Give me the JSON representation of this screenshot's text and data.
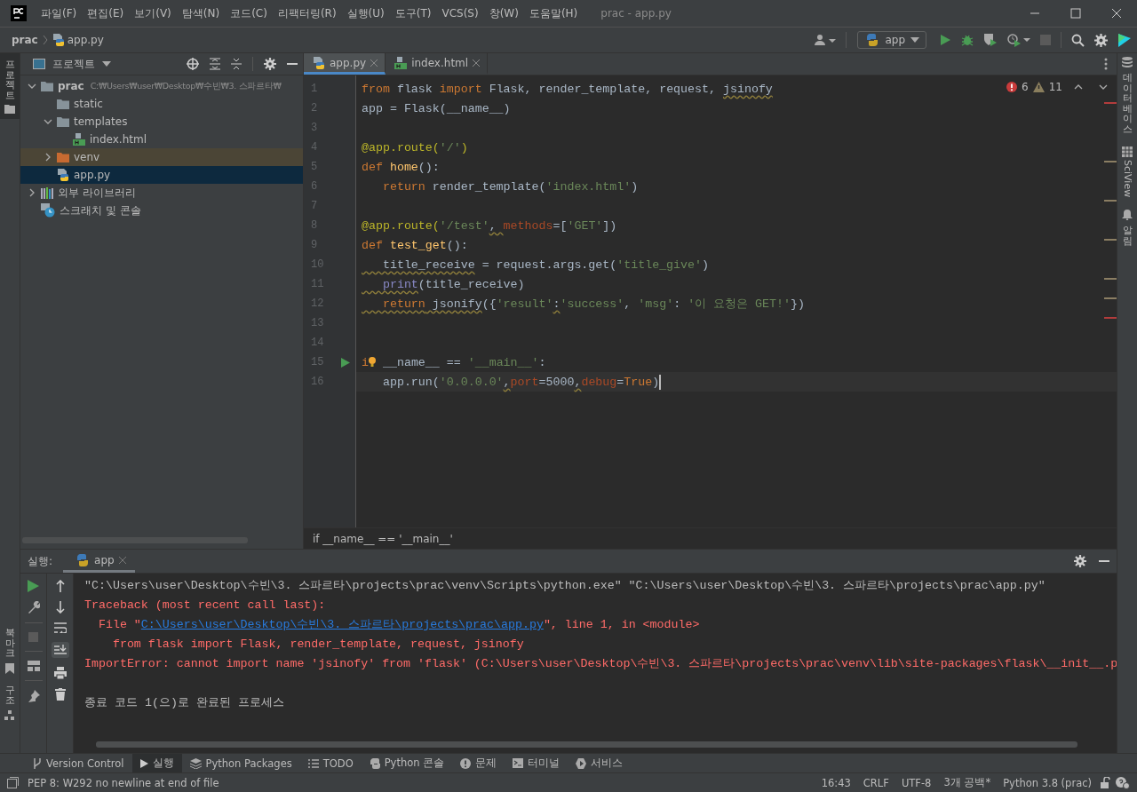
{
  "window": {
    "title": "prac - app.py",
    "menu": [
      "파일(F)",
      "편집(E)",
      "보기(V)",
      "탐색(N)",
      "코드(C)",
      "리팩터링(R)",
      "실행(U)",
      "도구(T)",
      "VCS(S)",
      "창(W)",
      "도움말(H)"
    ]
  },
  "navbar": {
    "breadcrumb": [
      "prac",
      "app.py"
    ],
    "run_config": "app"
  },
  "left_strip": [
    {
      "label": "프로젝트",
      "kind": "project",
      "selected": true
    },
    {
      "label": "북마크",
      "kind": "bookmark",
      "selected": false
    },
    {
      "label": "구조",
      "kind": "structure",
      "selected": false
    }
  ],
  "project": {
    "title": "프로젝트",
    "tree": [
      {
        "label": "prac",
        "path": "C:₩Users₩user₩Desktop₩수빈₩3. 스파르타₩",
        "kind": "folder",
        "expanded": true,
        "selected": false,
        "children": [
          {
            "label": "static",
            "kind": "folder",
            "selected": false
          },
          {
            "label": "templates",
            "kind": "folder",
            "expanded": true,
            "selected": false,
            "children": [
              {
                "label": "index.html",
                "kind": "html",
                "selected": false
              }
            ]
          },
          {
            "label": "venv",
            "kind": "excluded",
            "expanded": false,
            "selected": false
          },
          {
            "label": "app.py",
            "kind": "python",
            "selected": true
          }
        ]
      },
      {
        "label": "외부 라이브러리",
        "kind": "library",
        "expanded": false,
        "selected": false
      },
      {
        "label": "스크래치 및 콘솔",
        "kind": "scratch",
        "selected": false
      }
    ]
  },
  "editor": {
    "tabs": [
      {
        "label": "app.py",
        "kind": "python",
        "selected": true
      },
      {
        "label": "index.html",
        "kind": "html",
        "selected": false
      }
    ],
    "errors": "6",
    "warnings": "11",
    "lines": [
      {
        "number": "1",
        "tokens": [
          {
            "t": "from",
            "kind": "kw"
          },
          {
            "t": " flask ",
            "kind": "plain"
          },
          {
            "t": "import",
            "kind": "kw"
          },
          {
            "t": " Flask, render_template, request, ",
            "kind": "plain"
          },
          {
            "t": "jsinofy",
            "kind": "plain",
            "wavy": true
          }
        ]
      },
      {
        "number": "2",
        "tokens": [
          {
            "t": "app = Flask(__name__)",
            "kind": "plain"
          }
        ]
      },
      {
        "number": "3"
      },
      {
        "number": "4",
        "tokens": [
          {
            "t": "@app.route(",
            "kind": "deco"
          },
          {
            "t": "'/'",
            "kind": "str"
          },
          {
            "t": ")",
            "kind": "deco"
          }
        ]
      },
      {
        "number": "5",
        "tokens": [
          {
            "t": "def ",
            "kind": "kw"
          },
          {
            "t": "home",
            "kind": "fn"
          },
          {
            "t": "():",
            "kind": "plain"
          }
        ]
      },
      {
        "number": "6",
        "tokens": [
          {
            "t": "   return",
            "kind": "kw"
          },
          {
            "t": " render_template(",
            "kind": "plain"
          },
          {
            "t": "'index.html'",
            "kind": "str"
          },
          {
            "t": ")",
            "kind": "plain"
          }
        ]
      },
      {
        "number": "7"
      },
      {
        "number": "8",
        "tokens": [
          {
            "t": "@app.route(",
            "kind": "deco"
          },
          {
            "t": "'/test'",
            "kind": "str"
          },
          {
            "t": ", ",
            "kind": "plain",
            "wavy": true
          },
          {
            "t": "methods",
            "kind": "param"
          },
          {
            "t": "=[",
            "kind": "plain"
          },
          {
            "t": "'GET'",
            "kind": "str"
          },
          {
            "t": "])",
            "kind": "plain"
          }
        ]
      },
      {
        "number": "9",
        "tokens": [
          {
            "t": "def ",
            "kind": "kw"
          },
          {
            "t": "test_get",
            "kind": "fn"
          },
          {
            "t": "():",
            "kind": "plain"
          }
        ]
      },
      {
        "number": "10",
        "tokens": [
          {
            "t": "   title_receive",
            "kind": "plain",
            "wavy": true
          },
          {
            "t": " = request.args.get(",
            "kind": "plain"
          },
          {
            "t": "'title_give'",
            "kind": "str"
          },
          {
            "t": ")",
            "kind": "plain"
          }
        ]
      },
      {
        "number": "11",
        "tokens": [
          {
            "t": "   print",
            "kind": "builtin",
            "wavy": true
          },
          {
            "t": "(title_receive)",
            "kind": "plain"
          }
        ]
      },
      {
        "number": "12",
        "tokens": [
          {
            "t": "   return",
            "kind": "kw",
            "wavy": true
          },
          {
            "t": " jsonify",
            "kind": "plain",
            "wavy": true
          },
          {
            "t": "({",
            "kind": "plain"
          },
          {
            "t": "'result'",
            "kind": "str"
          },
          {
            "t": ":",
            "kind": "plain",
            "wavy": true
          },
          {
            "t": "'success'",
            "kind": "str"
          },
          {
            "t": ", ",
            "kind": "plain"
          },
          {
            "t": "'msg'",
            "kind": "str"
          },
          {
            "t": ": ",
            "kind": "plain"
          },
          {
            "t": "'이 요청은 GET!'",
            "kind": "str"
          },
          {
            "t": "})",
            "kind": "plain"
          }
        ]
      },
      {
        "number": "13"
      },
      {
        "number": "14"
      },
      {
        "number": "15",
        "run": true,
        "tokens": [
          {
            "t": "i",
            "kind": "kw"
          },
          {
            "kind": "bulb"
          },
          {
            "t": " __name__ == ",
            "kind": "plain"
          },
          {
            "t": "'__main__'",
            "kind": "str"
          },
          {
            "t": ":",
            "kind": "plain"
          }
        ]
      },
      {
        "number": "16",
        "current": true,
        "tokens": [
          {
            "t": "   app.run(",
            "kind": "plain"
          },
          {
            "t": "'0.0.0.0'",
            "kind": "str"
          },
          {
            "t": ",",
            "kind": "plain",
            "wavy": true
          },
          {
            "t": "port",
            "kind": "param"
          },
          {
            "t": "=5000",
            "kind": "plain"
          },
          {
            "t": ",",
            "kind": "plain",
            "wavy": true
          },
          {
            "t": "debug",
            "kind": "param"
          },
          {
            "t": "=",
            "kind": "plain"
          },
          {
            "t": "True",
            "kind": "kw"
          },
          {
            "t": ")",
            "kind": "plain"
          }
        ]
      }
    ],
    "breadcrumb": "if __name__ == '__main__'"
  },
  "right_strip": [
    {
      "label": "데이터베이스",
      "kind": "database"
    },
    {
      "label": "SciView",
      "kind": "sciview"
    },
    {
      "label": "알림",
      "kind": "bell"
    }
  ],
  "run": {
    "label": "실행:",
    "tab": "app",
    "lines": [
      {
        "segments": [
          {
            "t": "\"C:\\Users\\user\\Desktop\\수빈\\3. 스파르타\\projects\\prac\\venv\\Scripts\\python.exe\" \"C:\\Users\\user\\Desktop\\수빈\\3. 스파르타\\projects\\prac\\app.py\"",
            "kind": "normal"
          }
        ]
      },
      {
        "segments": [
          {
            "t": "Traceback (most recent call last):",
            "kind": "error"
          }
        ]
      },
      {
        "segments": [
          {
            "t": "  File \"",
            "kind": "error"
          },
          {
            "t": "C:\\Users\\user\\Desktop\\수빈\\3. 스파르타\\projects\\prac\\app.py",
            "kind": "link"
          },
          {
            "t": "\", line 1, in <module>",
            "kind": "error"
          }
        ]
      },
      {
        "segments": [
          {
            "t": "    from flask import Flask, render_template, request, jsinofy",
            "kind": "error"
          }
        ]
      },
      {
        "segments": [
          {
            "t": "ImportError: cannot import name 'jsinofy' from 'flask' (C:\\Users\\user\\Desktop\\수빈\\3. 스파르타\\projects\\prac\\venv\\lib\\site-packages\\flask\\__init__.p",
            "kind": "error"
          }
        ]
      },
      {
        "gap_before": true,
        "segments": [
          {
            "t": "종료 코드 1(으)로 완료된 프로세스",
            "kind": "normal"
          }
        ]
      }
    ]
  },
  "bottom_tabs": [
    {
      "label": "Version Control",
      "kind": "vcs",
      "selected": false
    },
    {
      "label": "실행",
      "kind": "run",
      "selected": true
    },
    {
      "label": "Python Packages",
      "kind": "packages",
      "selected": false
    },
    {
      "label": "TODO",
      "kind": "todo",
      "selected": false
    },
    {
      "label": "Python 콘솔",
      "kind": "console",
      "selected": false
    },
    {
      "label": "문제",
      "kind": "problems",
      "selected": false
    },
    {
      "label": "터미널",
      "kind": "terminal",
      "selected": false
    },
    {
      "label": "서비스",
      "kind": "services",
      "selected": false
    }
  ],
  "status_bar": {
    "message": "PEP 8: W292 no newline at end of file",
    "items": [
      "16:43",
      "CRLF",
      "UTF-8",
      "3개 공백*",
      "Python 3.8 (prac)"
    ]
  }
}
